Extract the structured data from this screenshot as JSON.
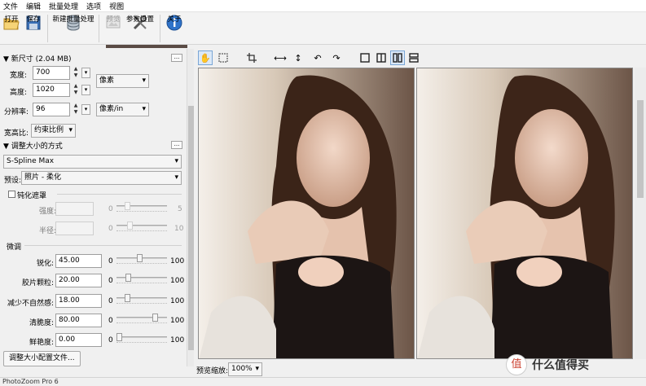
{
  "menu": [
    "文件",
    "编辑",
    "批量处理",
    "选项",
    "视图"
  ],
  "toolbar": {
    "open": "打开",
    "save": "保存",
    "new_batch": "新建批量处理",
    "preview": "预览",
    "settings": "参数设置",
    "about": "关于"
  },
  "new_size": {
    "header": "▼ 新尺寸 (2.04 MB)",
    "width_label": "宽度:",
    "width_value": "700",
    "height_label": "高度:",
    "height_value": "1020",
    "resolution_label": "分辨率:",
    "resolution_value": "96",
    "unit": "像素",
    "res_unit": "像素/in",
    "aspect_label": "宽高比:",
    "aspect_value": "约束比例"
  },
  "resize_method": {
    "header": "▼ 调整大小的方式",
    "method": "S-Spline Max",
    "preset_label": "预设:",
    "preset_value": "照片 - 柔化",
    "unsharp_label": "钝化遮罩",
    "strength_label": "强度:",
    "strength_min": "0",
    "strength_max": "5",
    "radius_label": "半径:",
    "radius_min": "0",
    "radius_max": "10"
  },
  "fine_tune": {
    "header": "微调",
    "rows": [
      {
        "label": "锐化:",
        "value": "45.00",
        "min": "0",
        "max": "100",
        "level": 0.45
      },
      {
        "label": "胶片颗粒:",
        "value": "20.00",
        "min": "0",
        "max": "100",
        "level": 0.2
      },
      {
        "label": "减少不自然感:",
        "value": "18.00",
        "min": "0",
        "max": "100",
        "level": 0.18
      },
      {
        "label": "清脆度:",
        "value": "80.00",
        "min": "0",
        "max": "100",
        "level": 0.8
      },
      {
        "label": "鲜艳度:",
        "value": "0.00",
        "min": "0",
        "max": "100",
        "level": 0.0
      }
    ]
  },
  "profile_button": "调整大小配置文件...",
  "zoom": {
    "label": "预览缩放:",
    "value": "100%"
  },
  "status": "PhotoZoom Pro 6",
  "watermark": "值 什么值得买"
}
